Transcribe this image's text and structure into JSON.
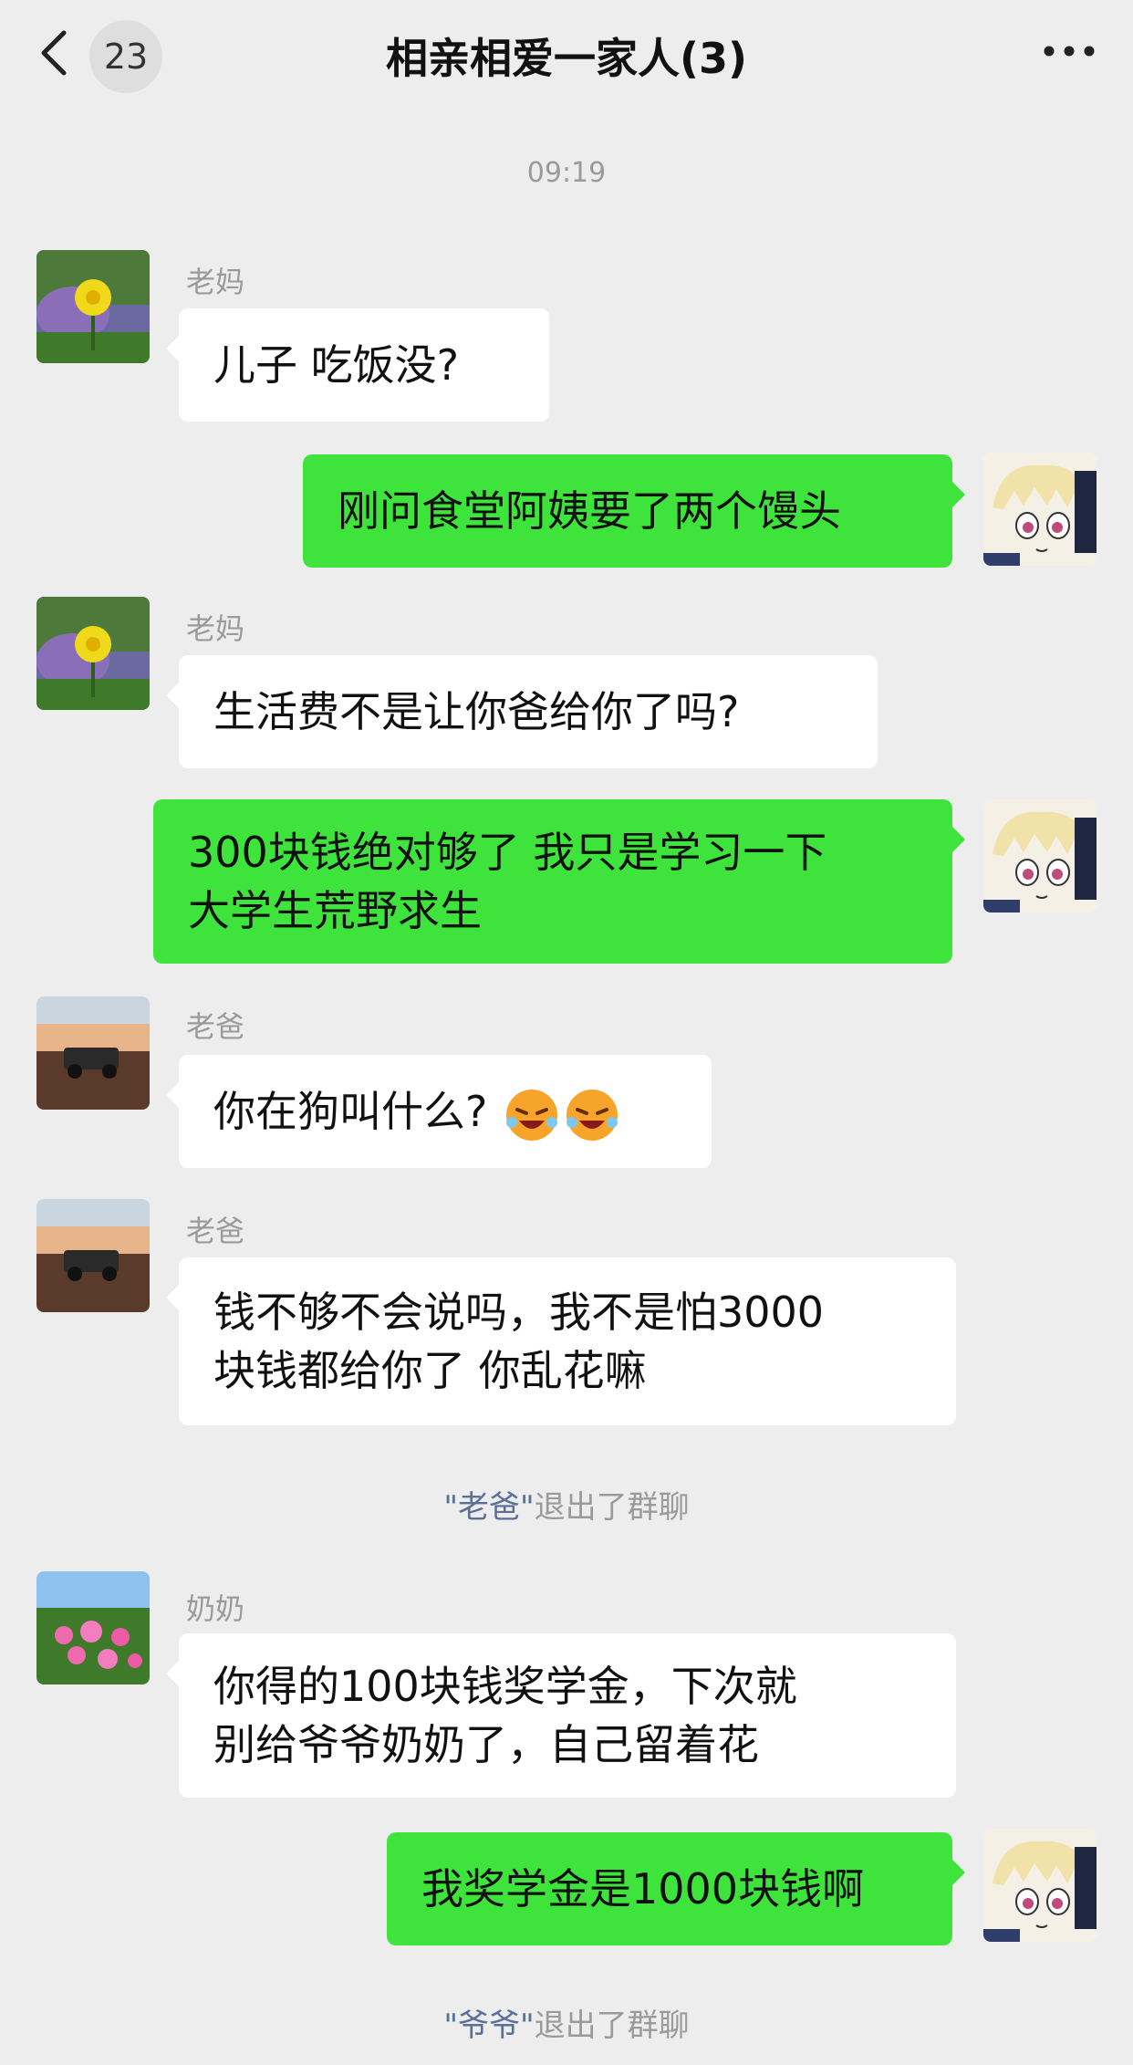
{
  "header": {
    "unread_count": "23",
    "title": "相亲相爱一家人(3)"
  },
  "timestamp": "09:19",
  "messages": [
    {
      "sender": "老妈",
      "side": "left",
      "avatar": "dandelion-avatar",
      "lines": [
        "儿子 吃饭没?"
      ]
    },
    {
      "sender": "",
      "side": "right",
      "avatar": "anime-avatar",
      "lines": [
        "刚问食堂阿姨要了两个馒头"
      ]
    },
    {
      "sender": "老妈",
      "side": "left",
      "avatar": "dandelion-avatar",
      "lines": [
        "生活费不是让你爸给你了吗?"
      ]
    },
    {
      "sender": "",
      "side": "right",
      "avatar": "anime-avatar",
      "lines": [
        "300块钱绝对够了 我只是学习一下",
        "大学生荒野求生"
      ]
    },
    {
      "sender": "老爸",
      "side": "left",
      "avatar": "car-avatar",
      "lines": [
        "你在狗叫什么?"
      ],
      "emojis": [
        "laughing-face-icon",
        "laughing-face-icon"
      ]
    },
    {
      "sender": "老爸",
      "side": "left",
      "avatar": "car-avatar",
      "lines": [
        "钱不够不会说吗，我不是怕3000",
        "块钱都给你了 你乱花嘛"
      ]
    },
    {
      "sender": "奶奶",
      "side": "left",
      "avatar": "flowers-avatar",
      "lines": [
        "你得的100块钱奖学金，下次就",
        "别给爷爷奶奶了，自己留着花"
      ]
    },
    {
      "sender": "",
      "side": "right",
      "avatar": "anime-avatar",
      "lines": [
        "我奖学金是1000块钱啊"
      ]
    }
  ],
  "system_messages": [
    {
      "name": "\"老爸\"",
      "text": "退出了群聊"
    },
    {
      "name": "\"爷爷\"",
      "text": "退出了群聊"
    }
  ],
  "colors": {
    "background": "#ededed",
    "self_bubble": "#3ee43b",
    "other_bubble": "#ffffff",
    "system_name": "#5b6f98"
  }
}
